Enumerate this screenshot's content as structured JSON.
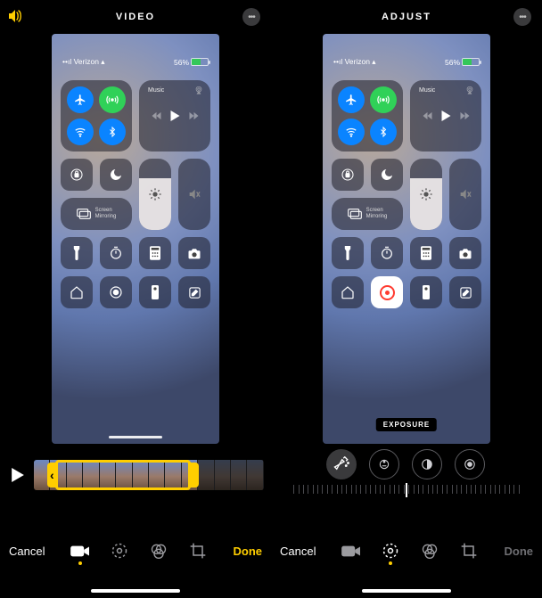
{
  "left": {
    "mode_title": "VIDEO",
    "cancel": "Cancel",
    "done": "Done",
    "status_carrier": "Verizon",
    "status_battery": "56%",
    "cc_music": "Music",
    "cc_screen_mirror": "Screen\nMirroring"
  },
  "right": {
    "mode_title": "ADJUST",
    "cancel": "Cancel",
    "done": "Done",
    "status_carrier": "Verizon",
    "status_battery": "56%",
    "cc_music": "Music",
    "cc_screen_mirror": "Screen\nMirroring",
    "exposure_label": "EXPOSURE"
  },
  "tools": [
    "video",
    "adjust",
    "filters",
    "crop"
  ],
  "adjust_dials": [
    "auto",
    "exposure",
    "highlights",
    "shadows"
  ],
  "colors": {
    "accent": "#ffce00"
  }
}
